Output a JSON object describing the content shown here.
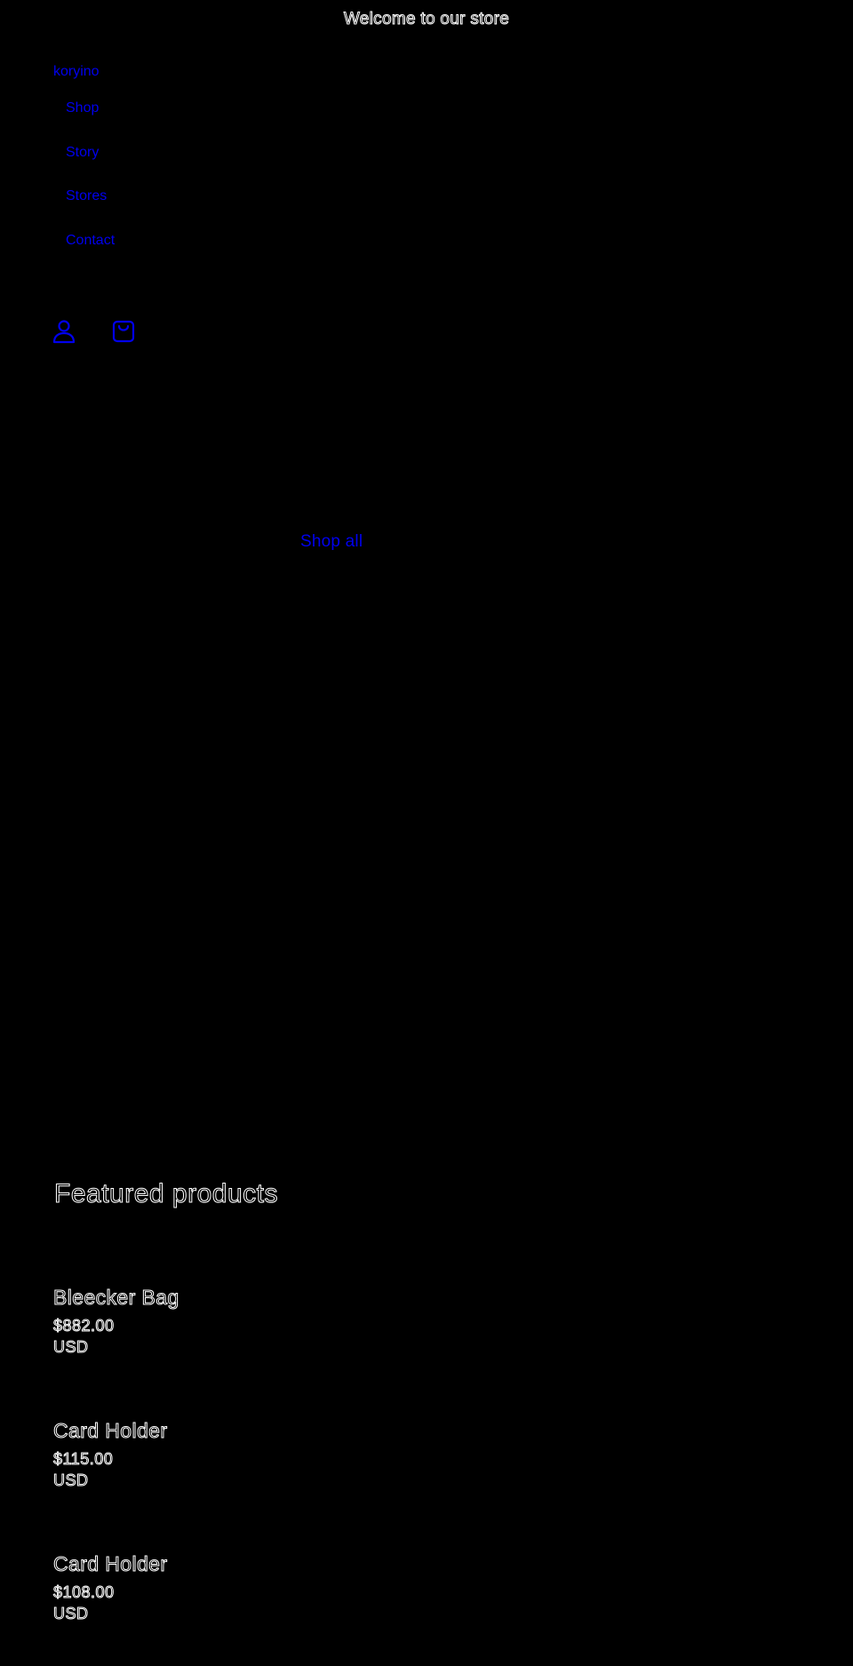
{
  "announcement": "Welcome to our store",
  "header": {
    "brand": "koryino",
    "nav": [
      {
        "label": "Shop"
      },
      {
        "label": "Story"
      },
      {
        "label": "Stores"
      },
      {
        "label": "Contact"
      }
    ],
    "icons": {
      "account": "account-icon",
      "cart": "cart-icon"
    },
    "link_color": "#0000ee"
  },
  "hero": {
    "button_label": "Shop all"
  },
  "featured": {
    "title": "Featured products",
    "products": [
      {
        "title": "Bleecker Bag",
        "price": "$882.00",
        "currency": "USD"
      },
      {
        "title": "Card Holder",
        "price": "$115.00",
        "currency": "USD"
      },
      {
        "title": "Card Holder",
        "price": "$108.00",
        "currency": "USD"
      }
    ]
  }
}
